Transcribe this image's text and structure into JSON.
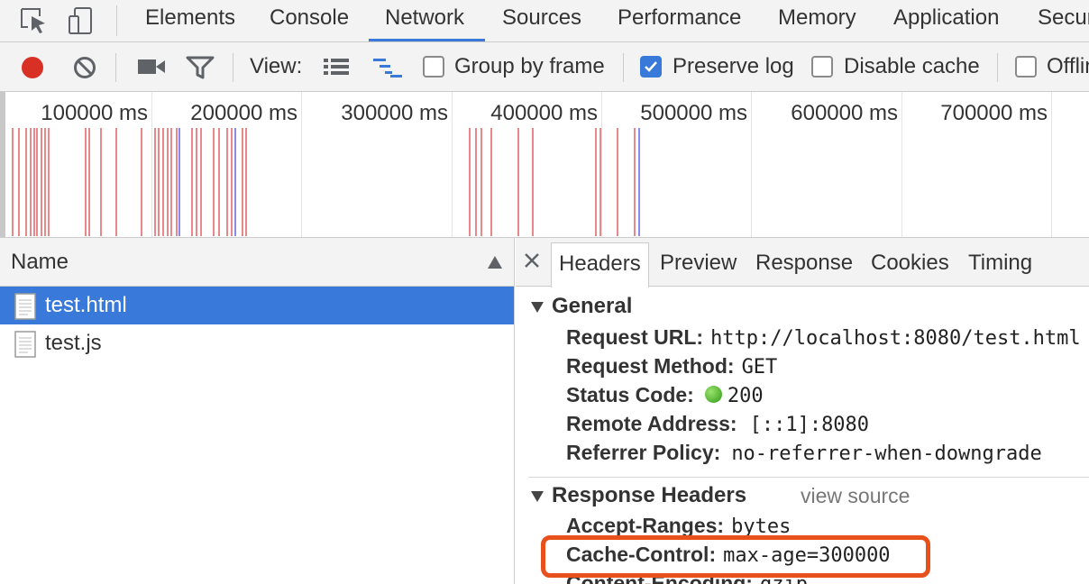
{
  "tabs": [
    "Elements",
    "Console",
    "Network",
    "Sources",
    "Performance",
    "Memory",
    "Application",
    "Security"
  ],
  "active_tab": "Network",
  "toolbar": {
    "view_label": "View:",
    "group_by_frame": {
      "label": "Group by frame",
      "checked": false
    },
    "preserve_log": {
      "label": "Preserve log",
      "checked": true
    },
    "disable_cache": {
      "label": "Disable cache",
      "checked": false
    },
    "offline": {
      "label": "Offline",
      "checked": false
    }
  },
  "overview": {
    "ticks": [
      "100000 ms",
      "200000 ms",
      "300000 ms",
      "400000 ms",
      "500000 ms",
      "600000 ms",
      "700000 ms"
    ]
  },
  "request_list": {
    "column": "Name",
    "rows": [
      {
        "name": "test.html",
        "selected": true
      },
      {
        "name": "test.js",
        "selected": false
      }
    ]
  },
  "details": {
    "tabs": [
      "Headers",
      "Preview",
      "Response",
      "Cookies",
      "Timing"
    ],
    "active_tab": "Headers",
    "general": {
      "title": "General",
      "rows": [
        {
          "name": "Request URL:",
          "value": "http://localhost:8080/test.html"
        },
        {
          "name": "Request Method:",
          "value": "GET"
        },
        {
          "name": "Status Code:",
          "value": "200"
        },
        {
          "name": "Remote Address:",
          "value": "[::1]:8080"
        },
        {
          "name": "Referrer Policy:",
          "value": "no-referrer-when-downgrade"
        }
      ]
    },
    "response_headers": {
      "title": "Response Headers",
      "view_source": "view source",
      "rows": [
        {
          "name": "Accept-Ranges:",
          "value": "bytes"
        },
        {
          "name": "Cache-Control:",
          "value": "max-age=300000"
        },
        {
          "name": "Content-Encoding:",
          "value": "gzip"
        }
      ]
    }
  },
  "colors": {
    "accent": "#3879d9",
    "record": "#d93025",
    "highlight": "#e8501c",
    "bar_red": "#e8888a",
    "bar_blue": "#8a8ae8",
    "status_ok": "#2e9a13"
  }
}
